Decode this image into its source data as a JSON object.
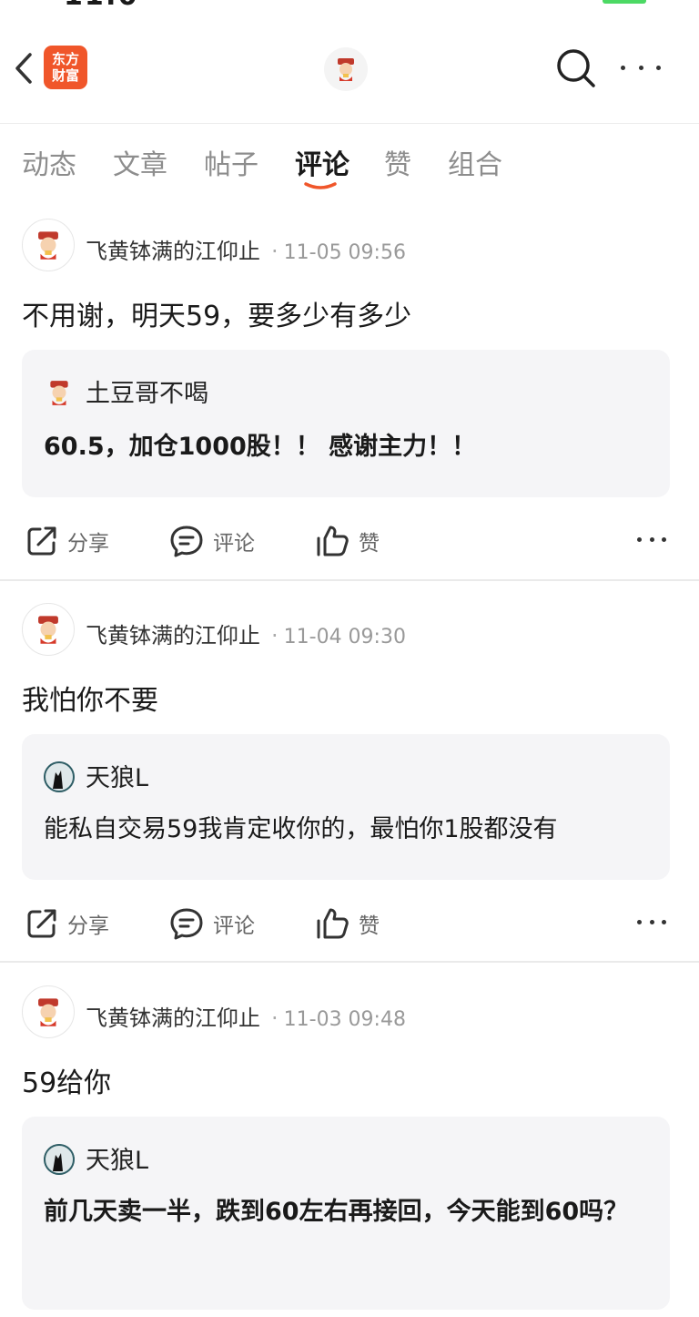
{
  "statusbar": {
    "time": "11:0"
  },
  "header": {
    "logo_text_line1": "东方",
    "logo_text_line2": "财富"
  },
  "tabs": [
    {
      "label": "动态"
    },
    {
      "label": "文章"
    },
    {
      "label": "帖子"
    },
    {
      "label": "评论",
      "active": true
    },
    {
      "label": "赞"
    },
    {
      "label": "组合"
    }
  ],
  "posts": [
    {
      "user": "飞黄钵满的江仰止",
      "time": "11-05 09:56",
      "text": "不用谢，明天59，要多少有多少",
      "quote": {
        "user": "土豆哥不喝",
        "text": "60.5，加仓1000股！！ 感谢主力！！",
        "bold": true,
        "avatar_icon": "caishen-avatar-icon"
      }
    },
    {
      "user": "飞黄钵满的江仰止",
      "time": "11-04 09:30",
      "text": "我怕你不要",
      "quote": {
        "user": "天狼L",
        "text": "能私自交易59我肯定收你的，最怕你1股都没有",
        "bold": false,
        "avatar_icon": "wolf-avatar-icon"
      }
    },
    {
      "user": "飞黄钵满的江仰止",
      "time": "11-03 09:48",
      "text": "59给你",
      "quote": {
        "user": "天狼L",
        "text": "前几天卖一半，跌到60左右再接回，今天能到60吗？",
        "bold": true,
        "avatar_icon": "wolf-avatar-icon"
      }
    }
  ],
  "actions": {
    "share": "分享",
    "comment": "评论",
    "like": "赞"
  },
  "colors": {
    "brand": "#f0562a",
    "quote_bg": "#f5f5f7",
    "divider": "#eaeaea"
  }
}
